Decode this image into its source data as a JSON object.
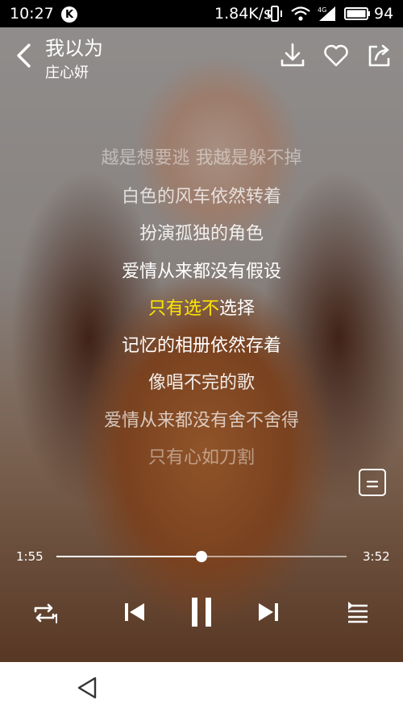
{
  "status_bar": {
    "time": "10:27",
    "k_badge": "K",
    "speed": "1.84K/s",
    "battery": "94"
  },
  "header": {
    "song_title": "我以为",
    "artist": "庄心妍"
  },
  "lyrics": {
    "lines": [
      "越是想要逃 我越是躲不掉",
      "白色的风车依然转着",
      "扮演孤独的角色",
      "爱情从来都没有假设",
      "只有选不选择",
      "记忆的相册依然存着",
      "像唱不完的歌",
      "爱情从来都没有舍不舍得",
      "只有心如刀割"
    ],
    "current_sung": "只有选不",
    "current_rest": "选择"
  },
  "player": {
    "current_time": "1:55",
    "total_time": "3:52",
    "progress": 0.5
  },
  "colors": {
    "highlight": "#ffe600"
  }
}
